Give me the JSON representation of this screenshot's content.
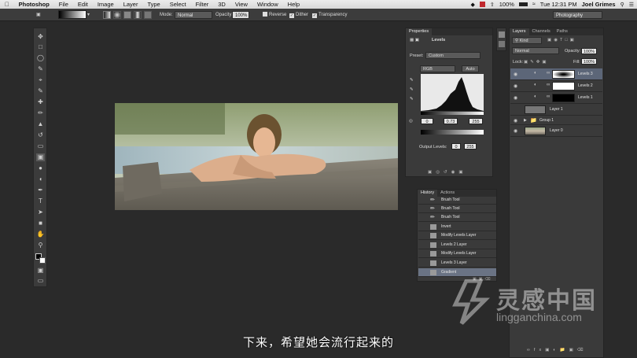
{
  "menubar": {
    "app": "Photoshop",
    "menus": [
      "File",
      "Edit",
      "Image",
      "Layer",
      "Type",
      "Select",
      "Filter",
      "3D",
      "View",
      "Window",
      "Help"
    ],
    "battery": "100%",
    "clock": "Tue 12:31 PM",
    "user": "Joel Grimes"
  },
  "options": {
    "mode_label": "Mode:",
    "mode_value": "Normal",
    "opacity_label": "Opacity:",
    "opacity_value": "100%",
    "reverse": "Reverse",
    "dither": "Dither",
    "transparency": "Transparency",
    "workspace": "Photography"
  },
  "properties": {
    "tab": "Properties",
    "type": "Levels",
    "preset_label": "Preset:",
    "preset_value": "Custom",
    "channel": "RGB",
    "auto": "Auto",
    "input_black": "0",
    "input_gamma": "0.73",
    "input_white": "255",
    "output_label": "Output Levels:",
    "output_black": "0",
    "output_white": "255"
  },
  "history": {
    "tabs": [
      "History",
      "Actions"
    ],
    "items": [
      "Brush Tool",
      "Brush Tool",
      "Brush Tool",
      "Invert",
      "Modify Levels Layer",
      "Levels 2 Layer",
      "Modify Levels Layer",
      "Levels 3 Layer",
      "Gradient"
    ],
    "selected_index": 8
  },
  "layers": {
    "tabs": [
      "Layers",
      "Channels",
      "Paths"
    ],
    "kind": "Kind",
    "blend": "Normal",
    "opacity_label": "Opacity:",
    "opacity_value": "100%",
    "lock_label": "Lock:",
    "fill_label": "Fill:",
    "fill_value": "100%",
    "rows": [
      {
        "name": "Levels 3"
      },
      {
        "name": "Levels 2"
      },
      {
        "name": "Levels 1"
      },
      {
        "name": "Layer 1"
      },
      {
        "name": "Group 1"
      },
      {
        "name": "Layer 0"
      }
    ]
  },
  "subtitle": "下来，希望她会流行起来的",
  "watermark": {
    "title": "灵感中国",
    "url": "lingganchina.com"
  }
}
